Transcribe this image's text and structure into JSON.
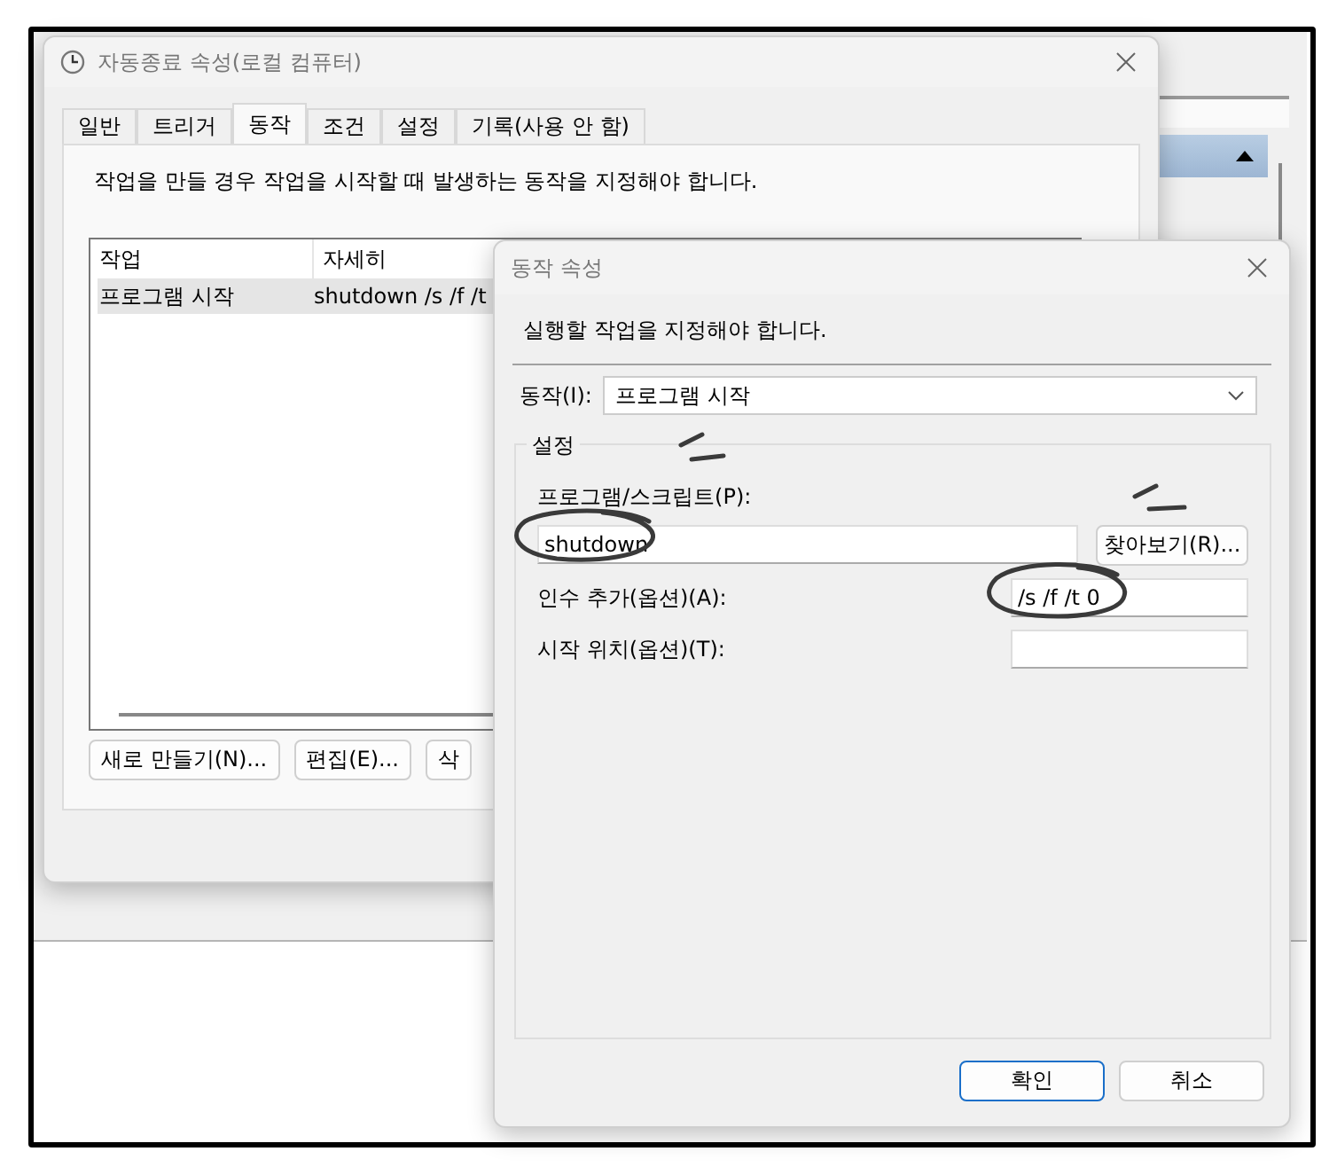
{
  "task_dialog": {
    "title": "자동종료 속성(로컬 컴퓨터)",
    "tabs": [
      {
        "label": "일반",
        "selected": false
      },
      {
        "label": "트리거",
        "selected": false
      },
      {
        "label": "동작",
        "selected": true
      },
      {
        "label": "조건",
        "selected": false
      },
      {
        "label": "설정",
        "selected": false
      },
      {
        "label": "기록(사용 안 함)",
        "selected": false
      }
    ],
    "description": "작업을 만들 경우 작업을 시작할 때 발생하는 동작을 지정해야 합니다.",
    "table": {
      "columns": [
        "작업",
        "자세히"
      ],
      "rows": [
        {
          "cells": [
            "프로그램 시작",
            "shutdown /s /f /t"
          ],
          "selected": true
        }
      ]
    },
    "buttons": [
      "새로 만들기(N)...",
      "편집(E)...",
      "삭"
    ]
  },
  "action_dialog": {
    "title": "동작 속성",
    "description": "실행할 작업을 지정해야 합니다.",
    "action": {
      "label": "동작(I):",
      "value": "프로그램 시작"
    },
    "group": {
      "title": "설정",
      "fields": [
        {
          "kind": "stacked",
          "label": "프로그램/스크립트(P):",
          "value": "shutdown",
          "button": "찾아보기(R)..."
        },
        {
          "kind": "inline",
          "label": "인수 추가(옵션)(A):",
          "value": "/s /f /t 0"
        },
        {
          "kind": "inline",
          "label": "시작 위치(옵션)(T):"
        }
      ]
    },
    "buttons": [
      {
        "label": "확인",
        "default": true
      },
      {
        "label": "취소",
        "default": false
      }
    ]
  }
}
